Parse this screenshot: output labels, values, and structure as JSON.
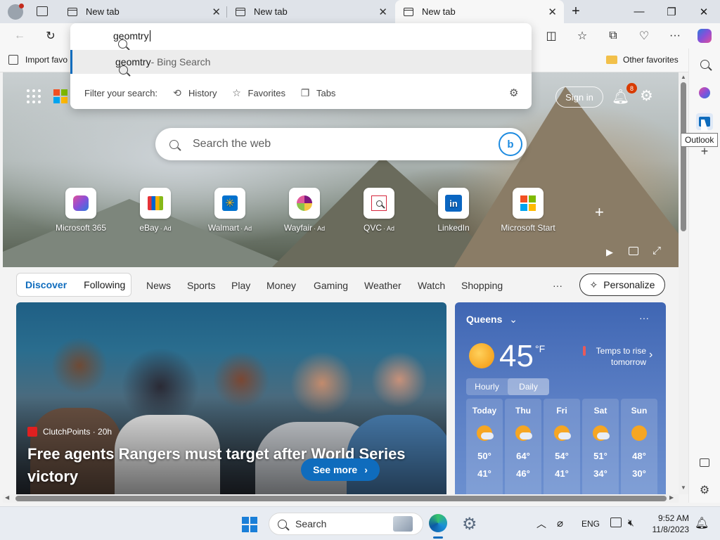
{
  "tabs": [
    {
      "label": "New tab"
    },
    {
      "label": "New tab"
    },
    {
      "label": "New tab"
    }
  ],
  "omnibox": {
    "query": "geomtry",
    "suggestion_main": "geomtry",
    "suggestion_suffix": " - Bing Search",
    "filter_label": "Filter your search:",
    "filters": [
      {
        "label": "History",
        "icon": "history-icon"
      },
      {
        "label": "Favorites",
        "icon": "star-icon"
      },
      {
        "label": "Tabs",
        "icon": "tabs-icon"
      }
    ]
  },
  "favbar": {
    "import_label": "Import favo",
    "other_favorites": "Other favorites"
  },
  "newtab": {
    "search_placeholder": "Search the web",
    "sign_in": "Sign in",
    "notification_count": "8",
    "quick_links": [
      {
        "label": "Microsoft 365",
        "ad": ""
      },
      {
        "label": "eBay",
        "ad": "· Ad"
      },
      {
        "label": "Walmart",
        "ad": "· Ad"
      },
      {
        "label": "Wayfair",
        "ad": "· Ad"
      },
      {
        "label": "QVC",
        "ad": "· Ad"
      },
      {
        "label": "LinkedIn",
        "ad": ""
      },
      {
        "label": "Microsoft Start",
        "ad": ""
      }
    ]
  },
  "feed": {
    "segment": [
      "Discover",
      "Following"
    ],
    "nav": [
      "News",
      "Sports",
      "Play",
      "Money",
      "Gaming",
      "Weather",
      "Watch",
      "Shopping"
    ],
    "more": "···",
    "personalize": "Personalize",
    "story": {
      "source": "ClutchPoints · 20h",
      "headline": "Free agents Rangers must target after World Series victory",
      "see_more": "See more"
    }
  },
  "weather": {
    "location": "Queens",
    "temp": "45",
    "unit": "°F",
    "note_line1": "Temps to rise",
    "note_line2": "tomorrow",
    "tabs": [
      "Hourly",
      "Daily"
    ],
    "days": [
      {
        "name": "Today",
        "hi": "50°",
        "lo": "41°"
      },
      {
        "name": "Thu",
        "hi": "64°",
        "lo": "46°"
      },
      {
        "name": "Fri",
        "hi": "54°",
        "lo": "41°"
      },
      {
        "name": "Sat",
        "hi": "51°",
        "lo": "34°"
      },
      {
        "name": "Sun",
        "hi": "48°",
        "lo": "30°"
      }
    ]
  },
  "sidebar": {
    "tooltip": "Outlook"
  },
  "taskbar": {
    "search_label": "Search",
    "lang": "ENG",
    "time": "9:52 AM",
    "date": "11/8/2023"
  },
  "colors": {
    "accent": "#0f6cbd",
    "weather_bg": "#4a70bc"
  }
}
